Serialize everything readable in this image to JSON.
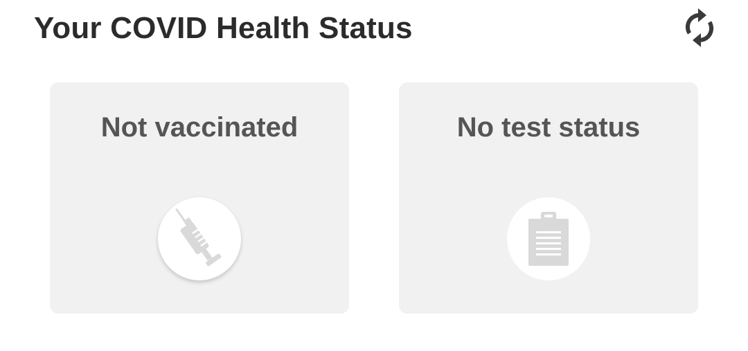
{
  "header": {
    "title": "Your COVID Health Status",
    "refresh_icon": "refresh-icon"
  },
  "cards": [
    {
      "title": "Not vaccinated",
      "icon": "syringe-icon"
    },
    {
      "title": "No test status",
      "icon": "clipboard-icon"
    }
  ],
  "colors": {
    "title_text": "#2b2b2b",
    "card_background": "#f1f1f1",
    "card_text": "#555555",
    "icon_fill": "#d9d9d9"
  }
}
